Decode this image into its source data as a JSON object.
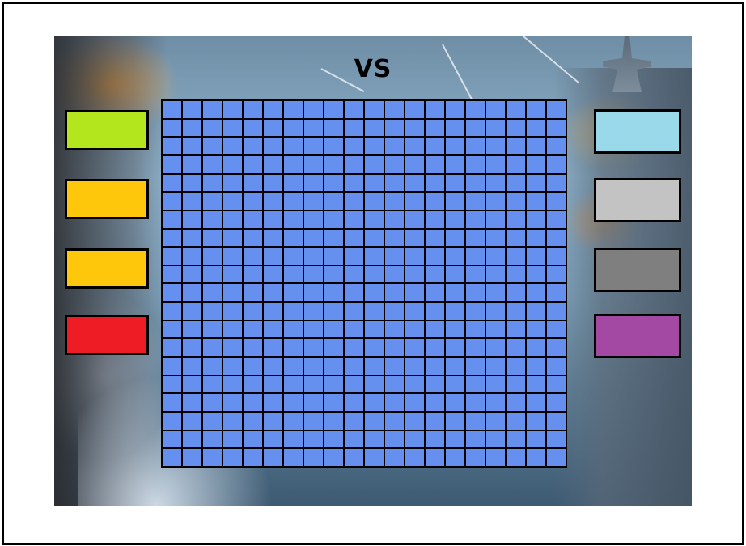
{
  "title": "VS",
  "board": {
    "columns": 20,
    "rows": 20,
    "cell_color": "#6690f0"
  },
  "left_swatches": [
    {
      "name": "green",
      "color": "#b4e61e"
    },
    {
      "name": "amber",
      "color": "#ffc70c"
    },
    {
      "name": "amber",
      "color": "#ffc70c"
    },
    {
      "name": "red",
      "color": "#ee1c24"
    }
  ],
  "right_swatches": [
    {
      "name": "light-blue",
      "color": "#99d9ea"
    },
    {
      "name": "light-gray",
      "color": "#c3c3c3"
    },
    {
      "name": "gray",
      "color": "#7f7f7f"
    },
    {
      "name": "purple",
      "color": "#a349a4"
    }
  ]
}
